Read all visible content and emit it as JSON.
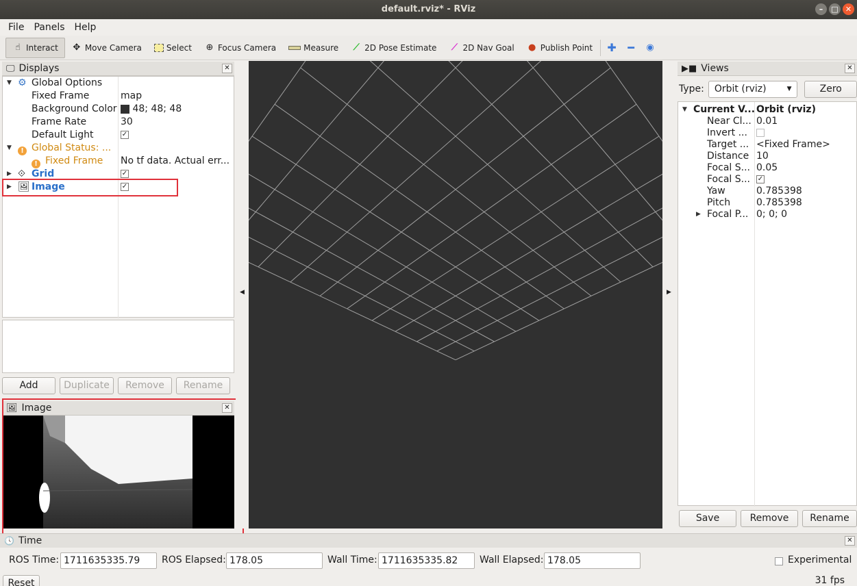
{
  "window": {
    "title": "default.rviz* - RViz"
  },
  "menu": [
    "File",
    "Panels",
    "Help"
  ],
  "toolbar": {
    "tools": [
      {
        "label": "Interact",
        "icon": "hand-pointer-icon",
        "active": true
      },
      {
        "label": "Move Camera",
        "icon": "move-camera-icon"
      },
      {
        "label": "Select",
        "icon": "select-box-icon"
      },
      {
        "label": "Focus Camera",
        "icon": "focus-camera-icon"
      },
      {
        "label": "Measure",
        "icon": "ruler-icon"
      },
      {
        "label": "2D Pose Estimate",
        "icon": "green-arrow-icon"
      },
      {
        "label": "2D Nav Goal",
        "icon": "magenta-arrow-icon"
      },
      {
        "label": "Publish Point",
        "icon": "map-pin-icon"
      }
    ]
  },
  "displays": {
    "title": "Displays",
    "global_options": "Global Options",
    "fixed_frame_label": "Fixed Frame",
    "fixed_frame_value": "map",
    "bg_color_label": "Background Color",
    "bg_color_value": "48; 48; 48",
    "frame_rate_label": "Frame Rate",
    "frame_rate_value": "30",
    "default_light_label": "Default Light",
    "global_status": "Global Status: ...",
    "status_fixed_frame": "Fixed Frame",
    "status_message": "No tf data.  Actual err...",
    "grid": "Grid",
    "image": "Image",
    "buttons": {
      "add": "Add",
      "duplicate": "Duplicate",
      "remove": "Remove",
      "rename": "Rename"
    }
  },
  "image_panel": {
    "title": "Image"
  },
  "views": {
    "title": "Views",
    "type_label": "Type:",
    "type_value": "Orbit (rviz)",
    "zero": "Zero",
    "current_view": "Current V...",
    "current_view_value": "Orbit (rviz)",
    "props": [
      {
        "label": "Near Cl...",
        "value": "0.01"
      },
      {
        "label": "Invert ...",
        "value": ""
      },
      {
        "label": "Target ...",
        "value": "<Fixed Frame>"
      },
      {
        "label": "Distance",
        "value": "10"
      },
      {
        "label": "Focal S...",
        "value": "0.05"
      },
      {
        "label": "Focal S...",
        "value": ""
      },
      {
        "label": "Yaw",
        "value": "0.785398"
      },
      {
        "label": "Pitch",
        "value": "0.785398"
      },
      {
        "label": "Focal P...",
        "value": "0; 0; 0"
      }
    ],
    "buttons": {
      "save": "Save",
      "remove": "Remove",
      "rename": "Rename"
    }
  },
  "time": {
    "title": "Time",
    "ros_time_label": "ROS Time:",
    "ros_time": "1711635335.79",
    "ros_elapsed_label": "ROS Elapsed:",
    "ros_elapsed": "178.05",
    "wall_time_label": "Wall Time:",
    "wall_time": "1711635335.82",
    "wall_elapsed_label": "Wall Elapsed:",
    "wall_elapsed": "178.05",
    "experimental": "Experimental",
    "reset": "Reset",
    "fps": "31 fps"
  },
  "colors": {
    "viewport_bg": "#303030",
    "highlight_box": "#e0313a",
    "link_blue": "#2a6fc9",
    "warn_orange": "#d08a12"
  }
}
